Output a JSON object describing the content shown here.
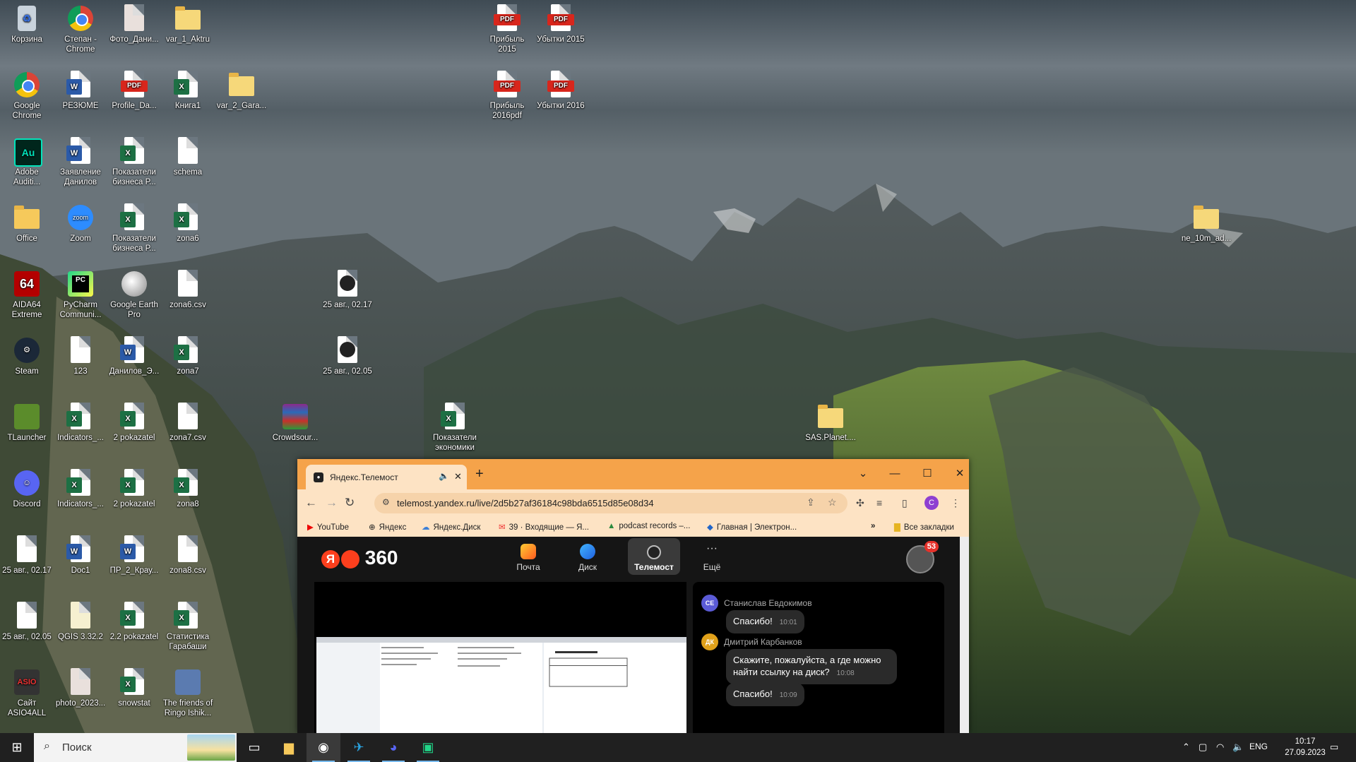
{
  "desktop": {
    "icons": [
      {
        "label": "Корзина",
        "kind": "bin"
      },
      {
        "label": "Степан - Chrome",
        "kind": "chrome"
      },
      {
        "label": "Фото_Дани...",
        "kind": "photo"
      },
      {
        "label": "var_1_Aktru",
        "kind": "zip"
      },
      {
        "label": "Прибыль 2015",
        "kind": "pdf"
      },
      {
        "label": "Убытки 2015",
        "kind": "pdf"
      },
      {
        "label": "Google Chrome",
        "kind": "chrome"
      },
      {
        "label": "РЕЗЮМЕ",
        "kind": "word"
      },
      {
        "label": "Profile_Da...",
        "kind": "pdf"
      },
      {
        "label": "Книга1",
        "kind": "excel"
      },
      {
        "label": "var_2_Gara...",
        "kind": "zip"
      },
      {
        "label": "Прибыль 2016pdf",
        "kind": "pdf"
      },
      {
        "label": "Убытки 2016",
        "kind": "pdf"
      },
      {
        "label": "Adobe Auditi...",
        "kind": "audition"
      },
      {
        "label": "Заявление Данилов",
        "kind": "word"
      },
      {
        "label": "Показатели бизнеса Р...",
        "kind": "excel"
      },
      {
        "label": "schema",
        "kind": "file"
      },
      {
        "label": "Office",
        "kind": "folder"
      },
      {
        "label": "Zoom",
        "kind": "zoom"
      },
      {
        "label": "Показатели бизнеса Р...",
        "kind": "excel"
      },
      {
        "label": "zona6",
        "kind": "excel"
      },
      {
        "label": "ne_10m_ad...",
        "kind": "zip"
      },
      {
        "label": "AIDA64 Extreme",
        "kind": "aida"
      },
      {
        "label": "PyCharm Communi...",
        "kind": "pycharm"
      },
      {
        "label": "Google Earth Pro",
        "kind": "earth"
      },
      {
        "label": "zona6.csv",
        "kind": "file"
      },
      {
        "label": "25 авг., 02.17",
        "kind": "video"
      },
      {
        "label": "Steam",
        "kind": "steam"
      },
      {
        "label": "123",
        "kind": "file"
      },
      {
        "label": "Данилов_Э...",
        "kind": "word"
      },
      {
        "label": "zona7",
        "kind": "excel"
      },
      {
        "label": "25 авг., 02.05",
        "kind": "video"
      },
      {
        "label": "TLauncher",
        "kind": "tlauncher"
      },
      {
        "label": "Indicators_...",
        "kind": "excel"
      },
      {
        "label": "2 pokazatel",
        "kind": "excel"
      },
      {
        "label": "zona7.csv",
        "kind": "file"
      },
      {
        "label": "Crowdsour...",
        "kind": "winrar"
      },
      {
        "label": "Показатели экономики",
        "kind": "excel"
      },
      {
        "label": "SAS.Planet....",
        "kind": "zip"
      },
      {
        "label": "Discord",
        "kind": "discord"
      },
      {
        "label": "Indicators_...",
        "kind": "excel"
      },
      {
        "label": "2 pokazatel",
        "kind": "excel"
      },
      {
        "label": "zona8",
        "kind": "excel"
      },
      {
        "label": "25 авг., 02.17",
        "kind": "pkf"
      },
      {
        "label": "Doc1",
        "kind": "word"
      },
      {
        "label": "ПР_2_Крау...",
        "kind": "word"
      },
      {
        "label": "zona8.csv",
        "kind": "file"
      },
      {
        "label": "25 авг., 02.05",
        "kind": "pkf"
      },
      {
        "label": "QGIS 3.32.2",
        "kind": "qgis"
      },
      {
        "label": "2.2 pokazatel",
        "kind": "excel"
      },
      {
        "label": "Статистика Гарабаши",
        "kind": "excel"
      },
      {
        "label": "Сайт ASIO4ALL",
        "kind": "asio"
      },
      {
        "label": "photo_2023...",
        "kind": "photo"
      },
      {
        "label": "snowstat",
        "kind": "excel"
      },
      {
        "label": "The friends of Ringo Ishik...",
        "kind": "ringo"
      }
    ]
  },
  "browser": {
    "tab_title": "Яндекс.Телемост",
    "url": "telemost.yandex.ru/live/2d5b27af36184c98bda6515d85e08d34",
    "profile_letter": "C",
    "bookmarks": [
      "YouTube",
      "Яндекс",
      "Яндекс.Диск",
      "39 · Входящие — Я...",
      "podcast records –...",
      "Главная | Электрон..."
    ],
    "bookmarks_more": "»",
    "all_bookmarks": "Все закладки",
    "page": {
      "logo_text": "360",
      "nav": [
        "Почта",
        "Диск",
        "Телемост",
        "Ещё"
      ],
      "notifications": "53",
      "chat": [
        {
          "initials": "СЕ",
          "author": "Станислав Евдокимов",
          "text": "Спасибо!",
          "time": "10:01",
          "color": "#5b5bd6"
        },
        {
          "initials": "ДК",
          "author": "Дмитрий Карбанков",
          "text": "Скажите, пожалуйста, а где можно найти ссылку на диск?",
          "time": "10:08",
          "color": "#e0a11a"
        },
        {
          "initials": "",
          "author": "",
          "text": "Спасибо!",
          "time": "10:09",
          "color": ""
        }
      ]
    }
  },
  "taskbar": {
    "search_placeholder": "Поиск",
    "language": "ENG",
    "time": "10:17",
    "date": "27.09.2023"
  }
}
